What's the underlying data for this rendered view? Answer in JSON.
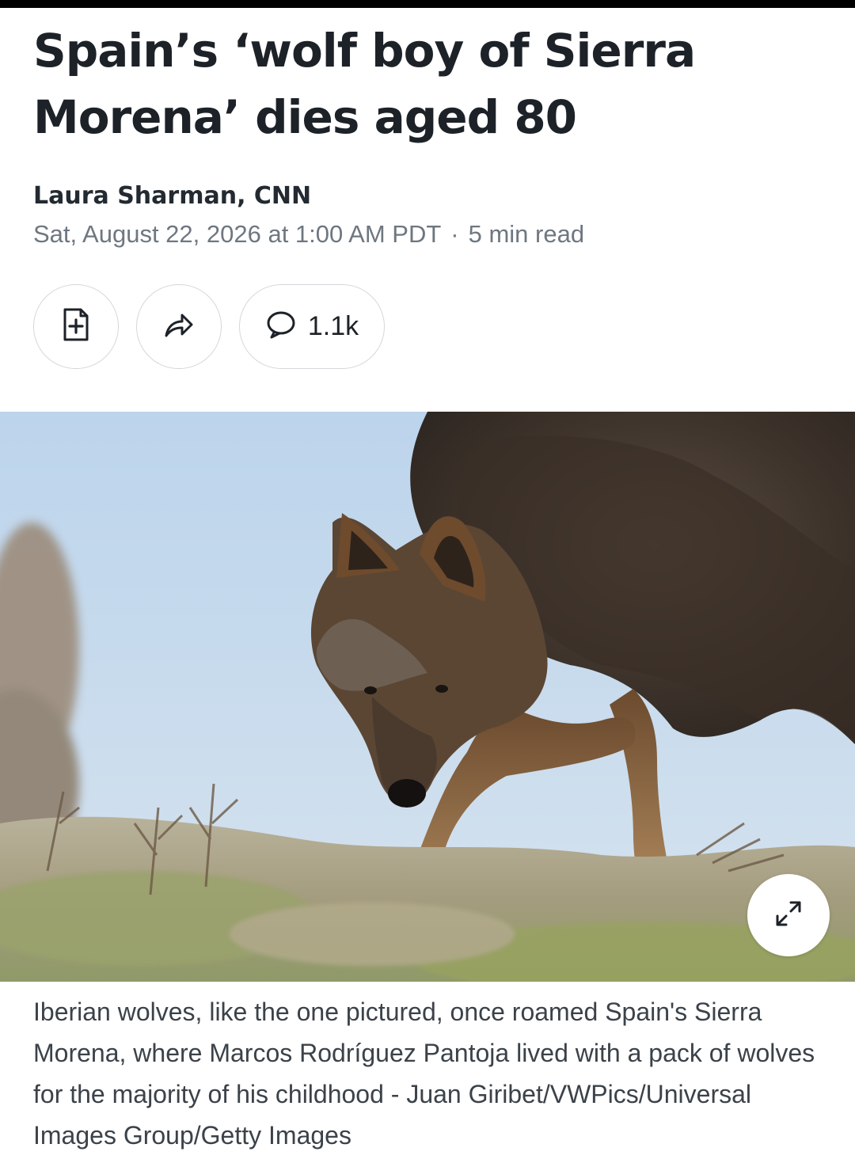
{
  "article": {
    "headline": "Spain’s ‘wolf boy of Sierra Morena’ dies aged 80",
    "byline": "Laura Sharman, CNN",
    "date": "Sat, August 22, 2026 at 1:00 AM PDT",
    "separator": "·",
    "read_time": "5 min read"
  },
  "actions": {
    "save_icon": "save-article-icon",
    "share_icon": "share-arrow-icon",
    "comment_icon": "comment-bubble-icon",
    "comment_count": "1.1k"
  },
  "hero_image": {
    "subject": "wolf",
    "expand_icon": "expand-icon"
  },
  "caption": "Iberian wolves, like the one pictured, once roamed Spain's Sierra Morena, where Marcos Rodríguez Pantoja lived with a pack of wolves for the majority of his childhood - Juan Giribet/VWPics/Universal Images Group/Getty Images"
}
